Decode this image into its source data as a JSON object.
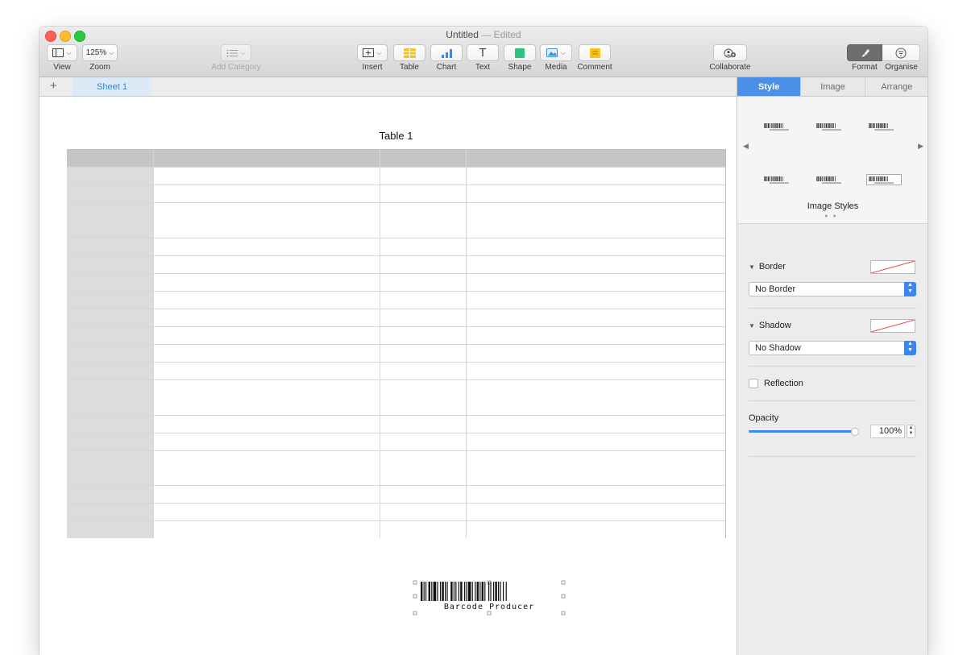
{
  "window": {
    "title": "Untitled",
    "status": "— Edited"
  },
  "toolbar": {
    "view_label": "View",
    "zoom_value": "125%",
    "zoom_label": "Zoom",
    "add_category_label": "Add Category",
    "insert_label": "Insert",
    "table_label": "Table",
    "chart_label": "Chart",
    "text_label": "Text",
    "text_glyph": "T",
    "shape_label": "Shape",
    "media_label": "Media",
    "comment_label": "Comment",
    "collaborate_label": "Collaborate",
    "format_label": "Format",
    "organise_label": "Organise"
  },
  "sheets": {
    "add_glyph": "+",
    "tabs": [
      "Sheet 1"
    ]
  },
  "table": {
    "title": "Table 1"
  },
  "barcode": {
    "caption": "Barcode Producer"
  },
  "sidebar": {
    "tabs": [
      "Style",
      "Image",
      "Arrange"
    ],
    "image_styles_label": "Image Styles",
    "border": {
      "label": "Border",
      "value": "No Border"
    },
    "shadow": {
      "label": "Shadow",
      "value": "No Shadow"
    },
    "reflection_label": "Reflection",
    "opacity": {
      "label": "Opacity",
      "value": "100%",
      "level": 1.0
    }
  },
  "colors": {
    "accent": "#4a8fe8",
    "sheet_tab_text": "#3a83d6",
    "header_row": "#c5c5c5",
    "header_column": "#dcdcdc"
  }
}
